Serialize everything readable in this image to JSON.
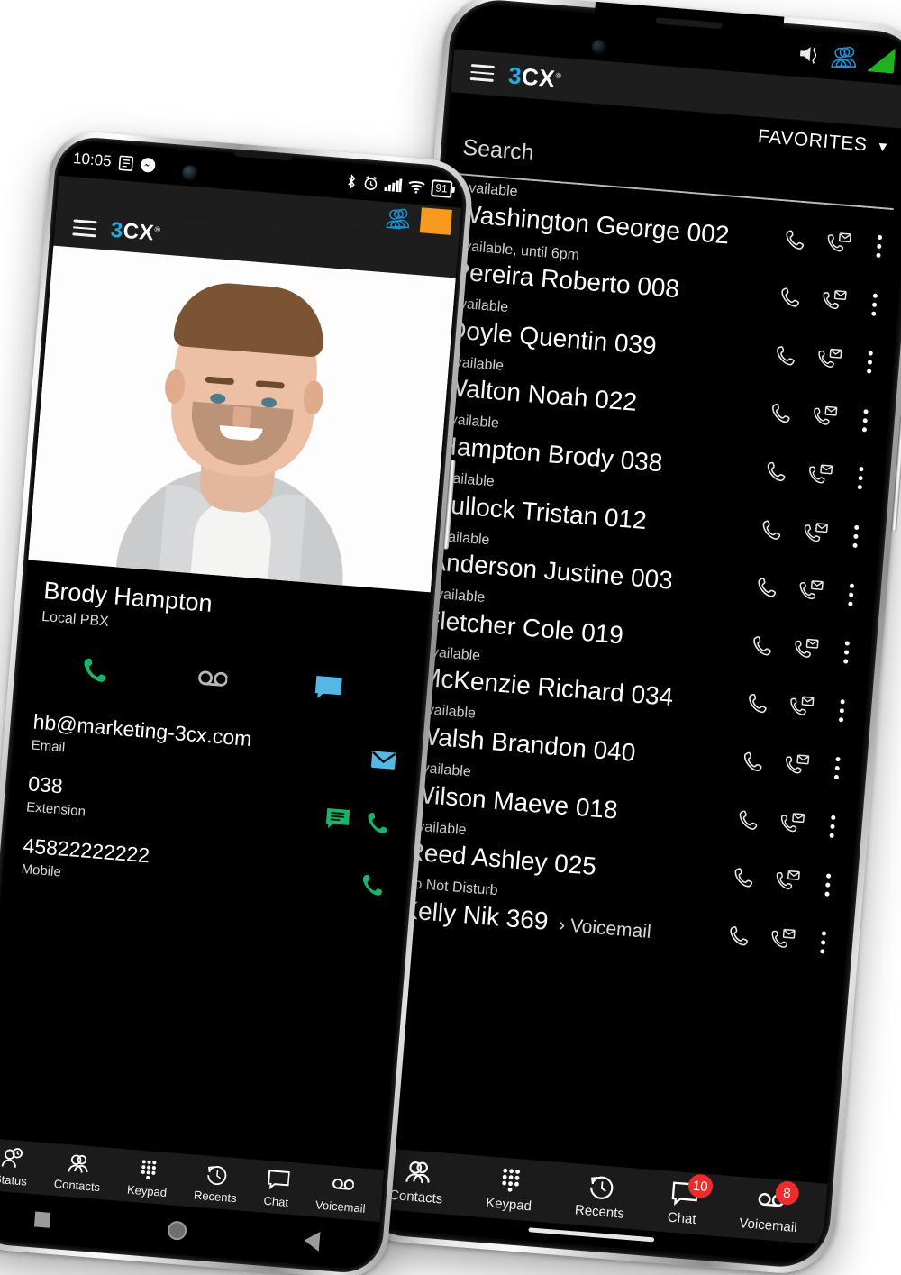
{
  "back_phone": {
    "status_bar": {
      "mute_icon": "mute-vibrate-icon",
      "contacts_icon": "contacts-presence-icon",
      "presence_color": "#22b11e"
    },
    "header": {
      "menu_icon": "hamburger-menu-icon",
      "logo_3": "3",
      "logo_cx": "CX",
      "logo_reg": "®"
    },
    "filter": {
      "label": "FAVORITES",
      "caret": "▼"
    },
    "search": {
      "placeholder": "Search",
      "value": "Search"
    },
    "contacts": [
      {
        "status": "Available",
        "name": "Washington George 002"
      },
      {
        "status": "Available,  until 6pm",
        "name": "Pereira Roberto 008"
      },
      {
        "status": "Available",
        "name": "Doyle Quentin 039"
      },
      {
        "status": "Available",
        "name": "Walton Noah 022"
      },
      {
        "status": "Available",
        "name": "Hampton Brody 038"
      },
      {
        "status": "Available",
        "name": "Bullock Tristan 012"
      },
      {
        "status": "Available",
        "name": "Anderson Justine 003"
      },
      {
        "status": "Available",
        "name": "Fletcher Cole 019"
      },
      {
        "status": "Available",
        "name": "McKenzie Richard 034"
      },
      {
        "status": "Available",
        "name": "Walsh Brandon 040"
      },
      {
        "status": "Available",
        "name": "Wilson Maeve 018"
      },
      {
        "status": "Available",
        "name": "Reed Ashley 025"
      },
      {
        "status": "Do Not Disturb",
        "name": "Kelly Nik 369",
        "forward": "› Voicemail"
      }
    ],
    "row_actions": {
      "call_icon": "phone-call-icon",
      "voicemail_call_icon": "call-voicemail-icon",
      "more_icon": "more-vertical-icon"
    },
    "tabs": [
      {
        "label": "Contacts",
        "icon": "contacts-icon",
        "badge": null
      },
      {
        "label": "Keypad",
        "icon": "keypad-icon",
        "badge": null
      },
      {
        "label": "Recents",
        "icon": "recents-icon",
        "badge": null
      },
      {
        "label": "Chat",
        "icon": "chat-icon",
        "badge": "10"
      },
      {
        "label": "Voicemail",
        "icon": "voicemail-icon",
        "badge": "8"
      }
    ]
  },
  "front_phone": {
    "status_bar": {
      "time": "10:05",
      "notif_icon_1": "notes-icon",
      "notif_icon_2": "messenger-icon",
      "bluetooth_icon": "bluetooth-icon",
      "alarm_icon": "alarm-icon",
      "signal_icon": "cellular-signal-icon",
      "wifi_icon": "wifi-icon",
      "battery_level": "91"
    },
    "header": {
      "menu_icon": "hamburger-menu-icon",
      "logo_3": "3",
      "logo_cx": "CX",
      "logo_reg": "®",
      "contacts_icon": "contacts-presence-icon",
      "status_square_color": "#f79a1e"
    },
    "contact": {
      "photo_alt": "contact-photo",
      "name": "Brody Hampton",
      "source": "Local PBX",
      "quick_actions": [
        {
          "icon": "call-icon",
          "color": "#19b36b"
        },
        {
          "icon": "voicemail-icon",
          "color": "#b7b7b7"
        },
        {
          "icon": "chat-icon",
          "color": "#55b7e6"
        }
      ],
      "fields": [
        {
          "value": "hb@marketing-3cx.com",
          "label": "Email",
          "icons": [
            {
              "icon": "email-icon",
              "color": "#55b7e6"
            }
          ]
        },
        {
          "value": "038",
          "label": "Extension",
          "icons": [
            {
              "icon": "message-icon",
              "color": "#19b36b"
            },
            {
              "icon": "call-icon",
              "color": "#19b36b"
            }
          ]
        },
        {
          "value": "45822222222",
          "label": "Mobile",
          "icons": [
            {
              "icon": "call-icon",
              "color": "#19b36b"
            }
          ]
        }
      ]
    },
    "tabs": [
      {
        "label": "Status",
        "icon": "status-icon"
      },
      {
        "label": "Contacts",
        "icon": "contacts-icon"
      },
      {
        "label": "Keypad",
        "icon": "keypad-icon"
      },
      {
        "label": "Recents",
        "icon": "recents-icon"
      },
      {
        "label": "Chat",
        "icon": "chat-icon"
      },
      {
        "label": "Voicemail",
        "icon": "voicemail-icon"
      }
    ],
    "nav": [
      {
        "icon": "recents-square-icon"
      },
      {
        "icon": "home-circle-icon"
      },
      {
        "icon": "back-triangle-icon"
      }
    ]
  }
}
